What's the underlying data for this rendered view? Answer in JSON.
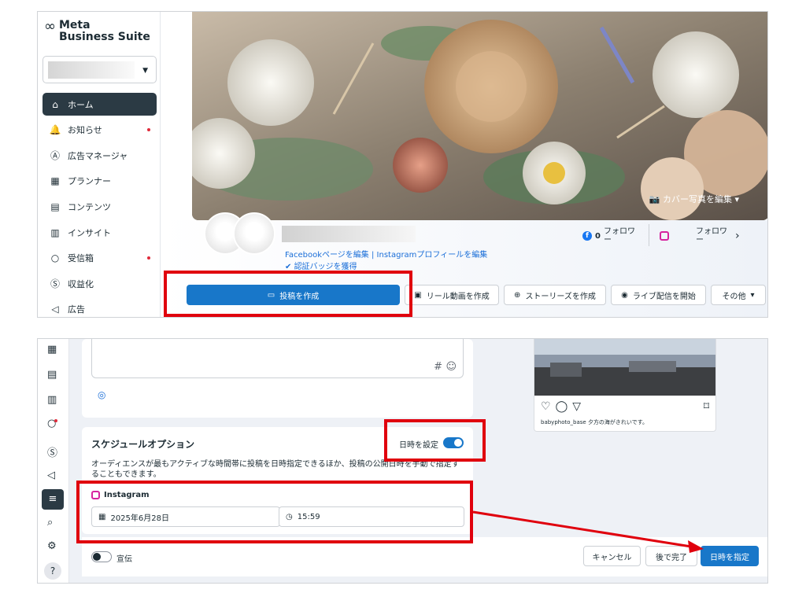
{
  "app": {
    "logo_mark": "∞",
    "logo_line1": "Meta",
    "logo_line2": "Business Suite"
  },
  "sidebar": {
    "items": [
      {
        "icon": "home-icon",
        "glyph": "⌂",
        "label": "ホーム",
        "active": true,
        "dot": false
      },
      {
        "icon": "bell-icon",
        "glyph": "🔔",
        "label": "お知らせ",
        "active": false,
        "dot": true
      },
      {
        "icon": "ads-manager-icon",
        "glyph": "Ⓐ",
        "label": "広告マネージャ",
        "active": false,
        "dot": false
      },
      {
        "icon": "calendar-icon",
        "glyph": "▦",
        "label": "プランナー",
        "active": false,
        "dot": false
      },
      {
        "icon": "content-icon",
        "glyph": "▤",
        "label": "コンテンツ",
        "active": false,
        "dot": false
      },
      {
        "icon": "insights-icon",
        "glyph": "▥",
        "label": "インサイト",
        "active": false,
        "dot": false
      },
      {
        "icon": "inbox-icon",
        "glyph": "○",
        "label": "受信箱",
        "active": false,
        "dot": true
      },
      {
        "icon": "monetize-icon",
        "glyph": "Ⓢ",
        "label": "収益化",
        "active": false,
        "dot": false
      },
      {
        "icon": "megaphone-icon",
        "glyph": "◁",
        "label": "広告",
        "active": false,
        "dot": false
      }
    ]
  },
  "cover": {
    "edit_label": "カバー写真を編集"
  },
  "profile": {
    "fb_link": "Facebookページを編集",
    "separator": "|",
    "ig_link": "Instagramプロフィールを編集",
    "badge_link": "認証バッジを獲得",
    "fb_count": "0",
    "fb_follow": "フォロワ",
    "fb_follow_sub": "ー",
    "ig_follow": "フォロワ",
    "ig_follow_sub": "ー",
    "chevron": "›"
  },
  "actions": {
    "create_post": "投稿を作成",
    "create_reel": "リール動画を作成",
    "create_story": "ストーリーズを作成",
    "go_live": "ライブ配信を開始",
    "more": "その他"
  },
  "composer": {
    "hashtag": "#",
    "emoji": "☺",
    "location_icon": "◎"
  },
  "preview": {
    "caption_user": "babyphoto_base",
    "caption_text": "夕方の海がきれいです。"
  },
  "schedule": {
    "title": "スケジュールオプション",
    "toggle_label": "日時を設定",
    "toggle_on": true,
    "description": "オーディエンスが最もアクティブな時間帯に投稿を日時指定できるほか、投稿の公開日時を手動で指定することもできます。",
    "platform": "Instagram",
    "date": "2025年6月28日",
    "time": "15:59"
  },
  "footer": {
    "boost_label": "宣伝",
    "cancel": "キャンセル",
    "later": "後で完了",
    "schedule": "日時を指定"
  },
  "colors": {
    "primary": "#1877c9",
    "highlight": "#e0000d",
    "dark": "#2b3a44"
  }
}
